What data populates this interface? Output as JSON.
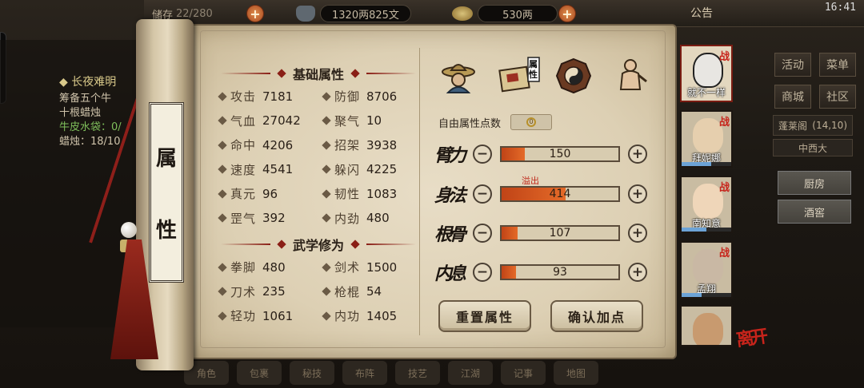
{
  "topbar": {
    "storage_label": "储存",
    "storage_value": "22/280",
    "money_copper": "1320两825文",
    "money_silver": "530两",
    "notice": "公告"
  },
  "status_bar": {
    "time": "16:41"
  },
  "quest": {
    "title": "长夜难明",
    "lines": [
      "筹备五个牛",
      "十根蜡烛",
      "牛皮水袋：0/",
      "蜡烛：18/10"
    ]
  },
  "right_menu": {
    "btn1": "活动",
    "btn2": "菜单",
    "btn3": "商城",
    "btn4": "社区",
    "location": "蓬莱阁",
    "location_coord": "(14,10)",
    "sub": "中西大",
    "room1": "厨房",
    "room2": "酒窖"
  },
  "scroll_label": [
    "属",
    "性"
  ],
  "basic": {
    "title": "基础属性",
    "stats": [
      {
        "name": "攻击",
        "value": "7181"
      },
      {
        "name": "防御",
        "value": "8706"
      },
      {
        "name": "气血",
        "value": "27042"
      },
      {
        "name": "聚气",
        "value": "10"
      },
      {
        "name": "命中",
        "value": "4206"
      },
      {
        "name": "招架",
        "value": "3938"
      },
      {
        "name": "速度",
        "value": "4541"
      },
      {
        "name": "躲闪",
        "value": "4225"
      },
      {
        "name": "真元",
        "value": "96"
      },
      {
        "name": "韧性",
        "value": "1083"
      },
      {
        "name": "罡气",
        "value": "392"
      },
      {
        "name": "内劲",
        "value": "480"
      }
    ]
  },
  "martial": {
    "title": "武学修为",
    "stats": [
      {
        "name": "拳脚",
        "value": "480"
      },
      {
        "name": "剑术",
        "value": "1500"
      },
      {
        "name": "刀术",
        "value": "235"
      },
      {
        "name": "枪棍",
        "value": "54"
      },
      {
        "name": "轻功",
        "value": "1061"
      },
      {
        "name": "内功",
        "value": "1405"
      }
    ]
  },
  "tabs": {
    "attr_tab_label": "属性"
  },
  "free_points": {
    "label": "自由属性点数",
    "value": "0"
  },
  "attributes": [
    {
      "name": "臂力",
      "value": "150",
      "fill": 0.2
    },
    {
      "name": "身法",
      "value": "414",
      "fill": 0.55
    },
    {
      "name": "根骨",
      "value": "107",
      "fill": 0.14
    },
    {
      "name": "内息",
      "value": "93",
      "fill": 0.12
    }
  ],
  "overflow_label": "溢出",
  "buttons": {
    "reset": "重置属性",
    "confirm": "确认加点"
  },
  "team": [
    {
      "name": "就不一样",
      "war": "战",
      "selected": true,
      "exp": 0.0
    },
    {
      "name": "拜妮娜",
      "war": "战",
      "selected": false,
      "exp": 0.6
    },
    {
      "name": "南知意",
      "war": "战",
      "selected": false,
      "exp": 0.5
    },
    {
      "name": "孟翔",
      "war": "战",
      "selected": false,
      "exp": 0.4
    },
    {
      "name": "",
      "war": "",
      "selected": false,
      "exp": 0.0
    }
  ],
  "leave_label": "离开",
  "bottom_tabs": [
    "角色",
    "包裹",
    "秘技",
    "布阵",
    "技艺",
    "江湖",
    "记事",
    "地图"
  ]
}
